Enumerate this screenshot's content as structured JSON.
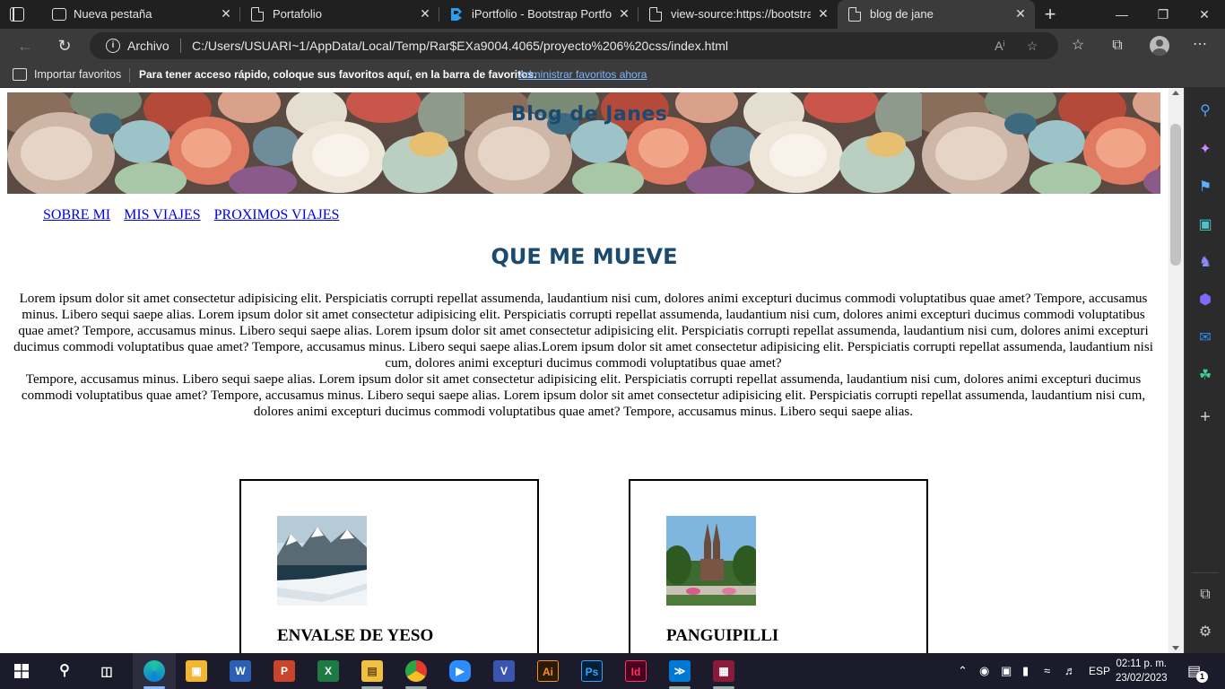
{
  "tabs": [
    {
      "title": "Nueva pestaña",
      "icon": "new-tab-page-icon"
    },
    {
      "title": "Portafolio",
      "icon": "document-icon"
    },
    {
      "title": "iPortfolio - Bootstrap Portfolio",
      "icon": "bootstrapmade-icon"
    },
    {
      "title": "view-source:https://bootstrap",
      "icon": "document-icon"
    },
    {
      "title": "blog de jane",
      "icon": "document-icon",
      "active": true
    }
  ],
  "address_bar": {
    "origin_label": "Archivo",
    "url": "C:/Users/USUARI~1/AppData/Local/Temp/Rar$EXa9004.4065/proyecto%206%20css/index.html"
  },
  "favorites_bar": {
    "import_label": "Importar favoritos",
    "hint": "Para tener acceso rápido, coloque sus favoritos aquí, en la barra de favoritos.",
    "manage_link": "Administrar favoritos ahora"
  },
  "page": {
    "banner_title": "Blog de Janes",
    "nav": [
      "SOBRE MI",
      "MIS VIAJES",
      "PROXIMOS VIAJES"
    ],
    "heading": "QUE ME MUEVE",
    "paragraph1": "Lorem ipsum dolor sit amet consectetur adipisicing elit. Perspiciatis corrupti repellat assumenda, laudantium nisi cum, dolores animi excepturi ducimus commodi voluptatibus quae amet? Tempore, accusamus minus. Libero sequi saepe alias. Lorem ipsum dolor sit amet consectetur adipisicing elit. Perspiciatis corrupti repellat assumenda, laudantium nisi cum, dolores animi excepturi ducimus commodi voluptatibus quae amet? Tempore, accusamus minus. Libero sequi saepe alias. Lorem ipsum dolor sit amet consectetur adipisicing elit. Perspiciatis corrupti repellat assumenda, laudantium nisi cum, dolores animi excepturi ducimus commodi voluptatibus quae amet? Tempore, accusamus minus. Libero sequi saepe alias.Lorem ipsum dolor sit amet consectetur adipisicing elit. Perspiciatis corrupti repellat assumenda, laudantium nisi cum, dolores animi excepturi ducimus commodi voluptatibus quae amet?",
    "paragraph2": "Tempore, accusamus minus. Libero sequi saepe alias. Lorem ipsum dolor sit amet consectetur adipisicing elit. Perspiciatis corrupti repellat assumenda, laudantium nisi cum, dolores animi excepturi ducimus commodi voluptatibus quae amet? Tempore, accusamus minus. Libero sequi saepe alias. Lorem ipsum dolor sit amet consectetur adipisicing elit. Perspiciatis corrupti repellat assumenda, laudantium nisi cum, dolores animi excepturi ducimus commodi voluptatibus quae amet? Tempore, accusamus minus. Libero sequi saepe alias.",
    "cards": [
      {
        "title": "ENVALSE DE YESO",
        "image": "mountain-lake-photo"
      },
      {
        "title": "PANGUIPILLI",
        "image": "church-photo"
      }
    ],
    "colors": {
      "heading": "#1a4a70",
      "link": "#0000ee"
    }
  },
  "taskbar": {
    "apps": [
      "start",
      "search",
      "task-view",
      "edge",
      "store",
      "word",
      "powerpoint",
      "excel",
      "file-explorer",
      "chrome",
      "zoom",
      "visio",
      "illustrator",
      "photoshop",
      "indesign",
      "vscode",
      "winrar"
    ],
    "labels": {
      "illustrator": "Ai",
      "photoshop": "Ps",
      "indesign": "Id"
    },
    "language": "ESP",
    "time": "02:11 p. m.",
    "date": "23/02/2023",
    "notification_count": "1"
  }
}
